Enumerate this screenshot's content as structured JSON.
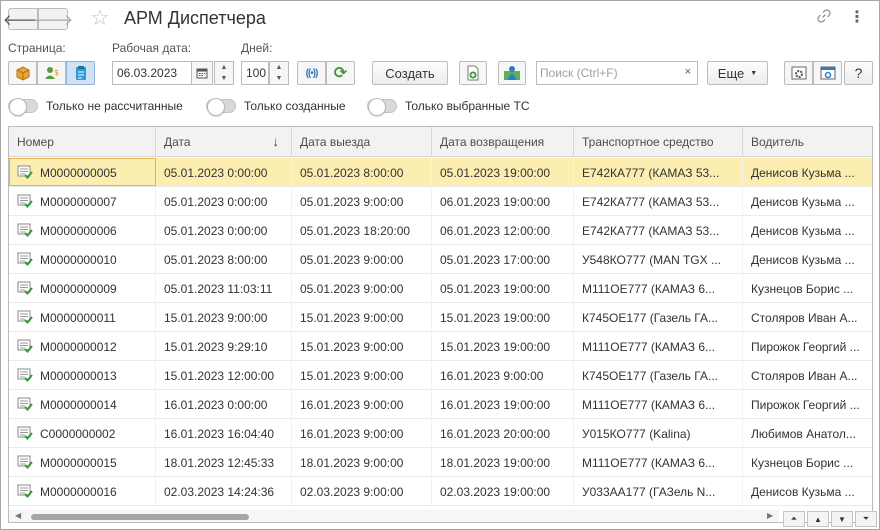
{
  "window": {
    "title": "АРМ Диспетчера"
  },
  "toolbar": {
    "page_label": "Страница:",
    "date_label": "Рабочая дата:",
    "date_value": "06.03.2023",
    "days_label": "Дней:",
    "days_value": "100",
    "create_label": "Создать",
    "search_placeholder": "Поиск (Ctrl+F)",
    "more_label": "Еще",
    "help_label": "?",
    "clear_label": "×"
  },
  "toggles": [
    {
      "label": "Только не рассчитанные"
    },
    {
      "label": "Только созданные"
    },
    {
      "label": "Только выбранные ТС"
    }
  ],
  "table": {
    "columns": [
      "Номер",
      "Дата",
      "Дата выезда",
      "Дата возвращения",
      "Транспортное средство",
      "Водитель"
    ],
    "rows": [
      [
        "М0000000005",
        "05.01.2023 0:00:00",
        "05.01.2023 8:00:00",
        "05.01.2023 19:00:00",
        "Е742КА777 (КАМАЗ 53...",
        "Денисов Кузьма ..."
      ],
      [
        "М0000000007",
        "05.01.2023 0:00:00",
        "05.01.2023 9:00:00",
        "06.01.2023 19:00:00",
        "Е742КА777 (КАМАЗ 53...",
        "Денисов Кузьма ..."
      ],
      [
        "М0000000006",
        "05.01.2023 0:00:00",
        "05.01.2023 18:20:00",
        "06.01.2023 12:00:00",
        "Е742КА777 (КАМАЗ 53...",
        "Денисов Кузьма ..."
      ],
      [
        "М0000000010",
        "05.01.2023 8:00:00",
        "05.01.2023 9:00:00",
        "05.01.2023 17:00:00",
        "У548КО777 (MAN TGX ...",
        "Денисов Кузьма ..."
      ],
      [
        "М0000000009",
        "05.01.2023 11:03:11",
        "05.01.2023 9:00:00",
        "05.01.2023 19:00:00",
        "М111ОЕ777 (КАМАЗ 6...",
        "Кузнецов Борис ..."
      ],
      [
        "М0000000011",
        "15.01.2023 9:00:00",
        "15.01.2023 9:00:00",
        "15.01.2023 19:00:00",
        "К745ОЕ177 (Газель ГА...",
        "Столяров Иван А..."
      ],
      [
        "М0000000012",
        "15.01.2023 9:29:10",
        "15.01.2023 9:00:00",
        "15.01.2023 19:00:00",
        "М111ОЕ777 (КАМАЗ 6...",
        "Пирожок Георгий ..."
      ],
      [
        "М0000000013",
        "15.01.2023 12:00:00",
        "15.01.2023 9:00:00",
        "16.01.2023 9:00:00",
        "К745ОЕ177 (Газель ГА...",
        "Столяров Иван А..."
      ],
      [
        "М0000000014",
        "16.01.2023 0:00:00",
        "16.01.2023 9:00:00",
        "16.01.2023 19:00:00",
        "М111ОЕ777 (КАМАЗ 6...",
        "Пирожок Георгий ..."
      ],
      [
        "С0000000002",
        "16.01.2023 16:04:40",
        "16.01.2023 9:00:00",
        "16.01.2023 20:00:00",
        "У015КО777 (Kalina)",
        "Любимов Анатол..."
      ],
      [
        "М0000000015",
        "18.01.2023 12:45:33",
        "18.01.2023 9:00:00",
        "18.01.2023 19:00:00",
        "М111ОЕ777 (КАМАЗ 6...",
        "Кузнецов Борис ..."
      ],
      [
        "М0000000016",
        "02.03.2023 14:24:36",
        "02.03.2023 9:00:00",
        "02.03.2023 19:00:00",
        "У033АА177 (ГАЗель N...",
        "Денисов Кузьма ..."
      ]
    ],
    "selected_row": 0,
    "sort_column": "Дата",
    "sort_direction": "descending"
  },
  "colors": {
    "selected_row": "#fbeeb0",
    "accent_green": "#3a9a3a",
    "header_bg": "#f2f2f2"
  }
}
